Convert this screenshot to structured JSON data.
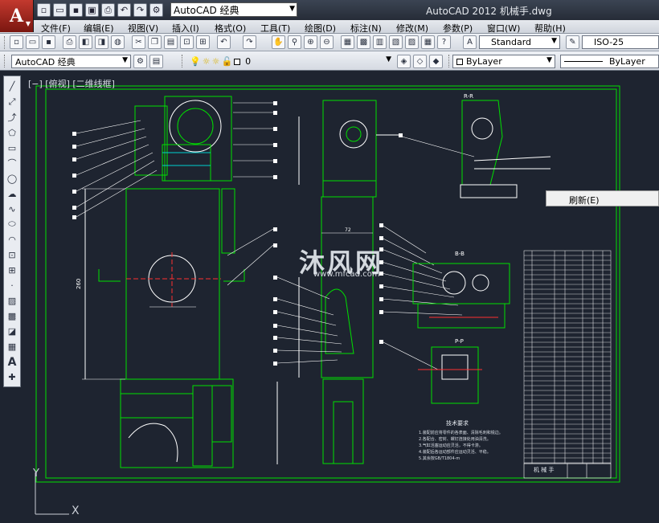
{
  "app": {
    "window_title": "AutoCAD 2012    机械手.dwg",
    "logo_letter": "A",
    "workspace": "AutoCAD 经典"
  },
  "menu": {
    "items": [
      "文件(F)",
      "编辑(E)",
      "视图(V)",
      "插入(I)",
      "格式(O)",
      "工具(T)",
      "绘图(D)",
      "标注(N)",
      "修改(M)",
      "参数(P)",
      "窗口(W)",
      "帮助(H)"
    ]
  },
  "toolbar": {
    "text_style": "Standard",
    "dim_style": "ISO-25",
    "workspace2": "AutoCAD 经典",
    "layer": "0",
    "color": "ByLayer",
    "linetype": "ByLayer"
  },
  "viewport": {
    "label": "[−] [俯视] [二维线框]"
  },
  "context_menu": {
    "item": "刷新(E)"
  },
  "watermark": {
    "text": "沐风网",
    "url": "www.mfcad.com"
  },
  "drawing": {
    "section_bb": "B-B",
    "section_pp": "P-P",
    "section_rr": "R-R",
    "dim_260": "260",
    "dim_72": "72",
    "tech_title": "技术要求",
    "tech_lines": [
      "1.装配前应将零件的各表面、清除毛刺和锐边。",
      "2.各配合、密封、螺钉连接处用油清洗。",
      "3.气缸活塞运动应灵活，不得卡滞。",
      "4.装配后各运动部件应运动灵活、平稳。",
      "5.其余按GB/T1804-m"
    ],
    "title_block": "机 械 手"
  },
  "colors": {
    "canvas_bg": "#1e2430",
    "green": "#00e000",
    "white": "#ffffff",
    "red": "#e02020",
    "cyan": "#00d0d0"
  }
}
